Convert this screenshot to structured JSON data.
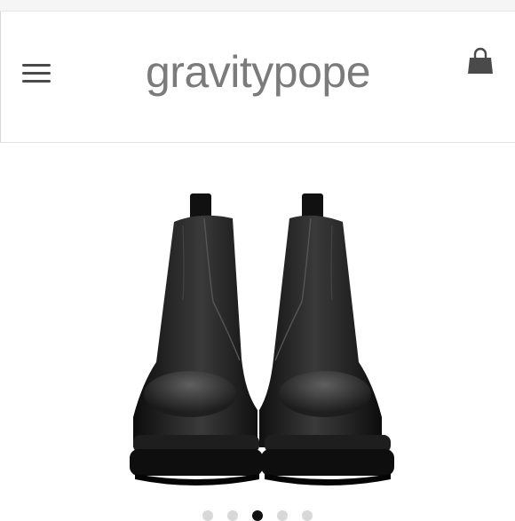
{
  "header": {
    "logo_text": "gravitypope",
    "menu_icon": "hamburger-menu-icon",
    "cart_icon": "shopping-bag-icon"
  },
  "product": {
    "image": "black-leather-chelsea-boots-pair",
    "carousel": {
      "total": 5,
      "active_index": 2
    }
  },
  "colors": {
    "logo": "#7b7b7b",
    "icon": "#4a4a4a",
    "boot_leather": "#1b1b1b",
    "dot_active": "#111111",
    "dot_inactive": "#d8d8d8"
  }
}
